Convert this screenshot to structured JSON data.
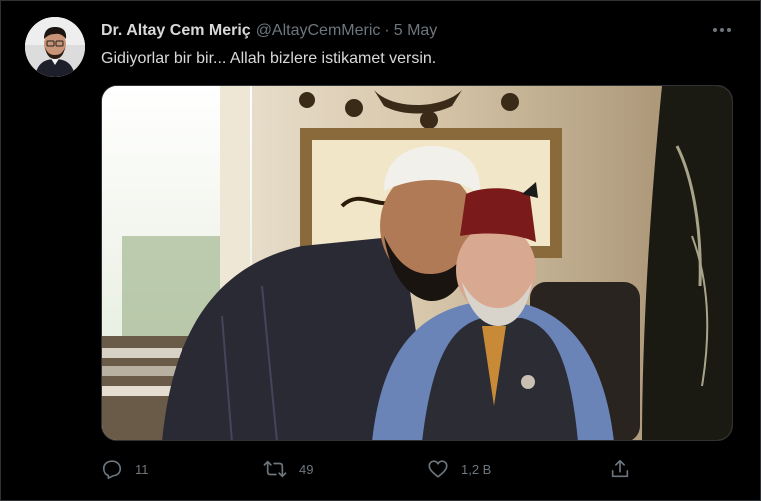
{
  "user": {
    "display_name": "Dr. Altay Cem Meriç",
    "handle": "@AltayCemMeric",
    "separator": "·",
    "date": "5 May",
    "avatar_icon": "profile-photo"
  },
  "tweet": {
    "text": "Gidiyorlar bir bir... Allah bizlere istikamet versin.",
    "media_alt": "photo-two-men-embracing-in-office"
  },
  "actions": {
    "reply_count": "11",
    "retweet_count": "49",
    "like_count": "1,2 B",
    "share_icon": "share-icon"
  },
  "colors": {
    "background": "#000000",
    "text": "#d9d9d9",
    "muted": "#6e767d",
    "border": "#2f3336"
  }
}
